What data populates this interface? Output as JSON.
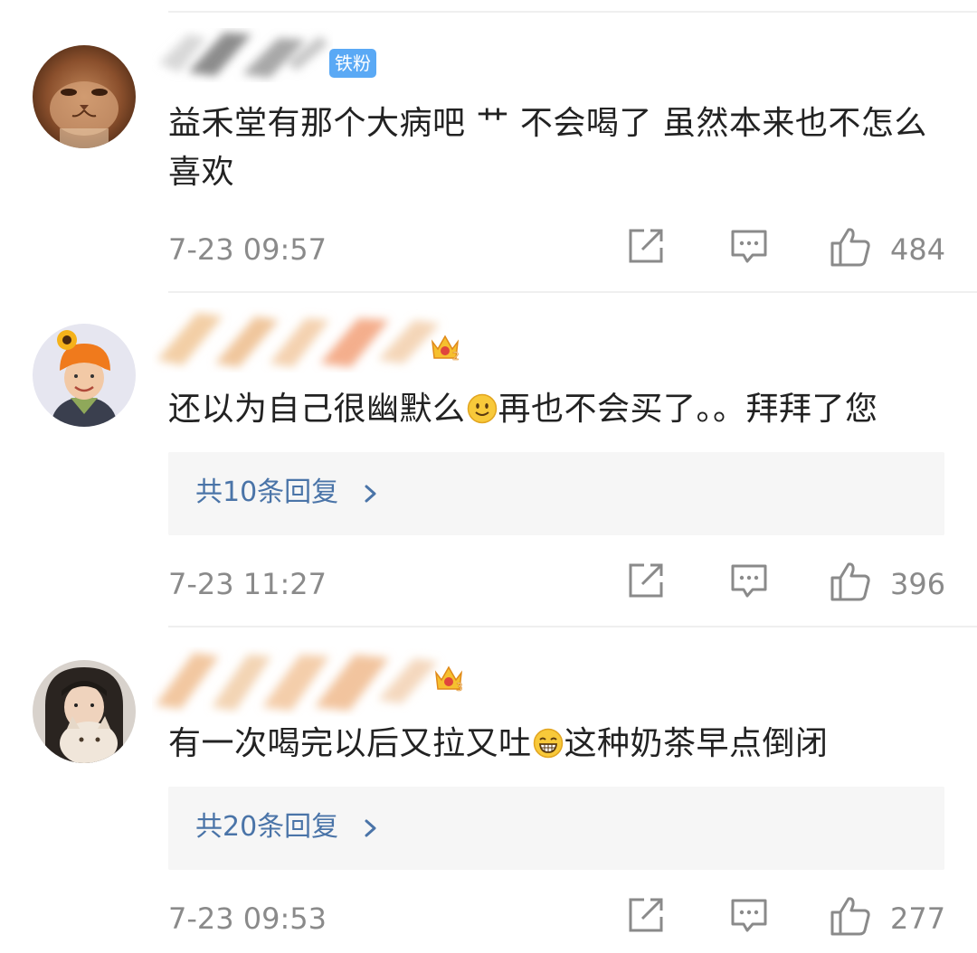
{
  "colors": {
    "text": "#222222",
    "muted": "#8a8a8a",
    "link": "#4a74a8",
    "badge_blue": "#5aa9f5",
    "reply_bg": "#f6f6f6",
    "divider": "#efefef"
  },
  "comments": [
    {
      "avatar": "cat-face-avatar",
      "badge_text": "铁粉",
      "text": "益禾堂有那个大病吧 艹 不会喝了 虽然本来也不怎么喜欢",
      "timestamp": "7-23 09:57",
      "likes": "484",
      "icons": {
        "share": "share-icon",
        "reply": "comment-icon",
        "like": "thumbs-up-icon"
      }
    },
    {
      "avatar": "person-sunflower-hat-avatar",
      "badge_icon": "crown-level-2-icon",
      "text_part1": "还以为自己很幽默么",
      "text_emoji": "smile-emoji",
      "text_part2": "再也不会买了。。拜拜了您",
      "replies_label": "共10条回复",
      "timestamp": "7-23 11:27",
      "likes": "396",
      "icons": {
        "share": "share-icon",
        "reply": "comment-icon",
        "like": "thumbs-up-icon"
      }
    },
    {
      "avatar": "person-with-cat-avatar",
      "badge_icon": "crown-level-3-icon",
      "text_part1": "有一次喝完以后又拉又吐",
      "text_emoji": "grin-emoji",
      "text_part2": "这种奶茶早点倒闭",
      "replies_label": "共20条回复",
      "timestamp": "7-23 09:53",
      "likes": "277",
      "icons": {
        "share": "share-icon",
        "reply": "comment-icon",
        "like": "thumbs-up-icon"
      }
    }
  ]
}
